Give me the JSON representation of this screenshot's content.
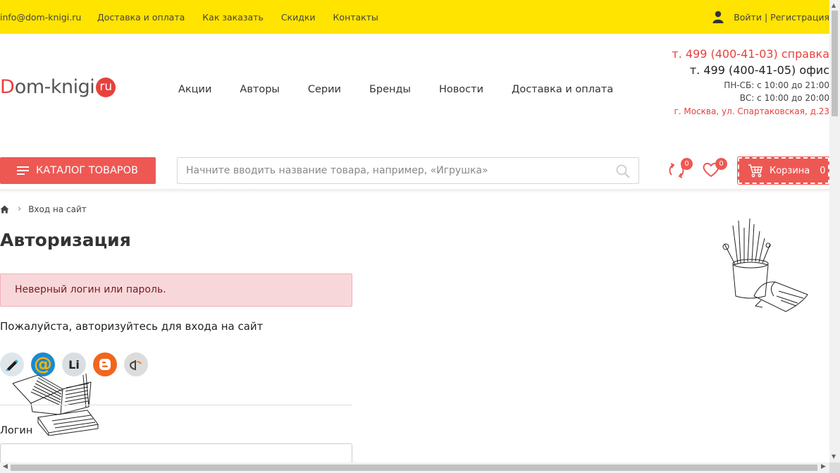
{
  "topbar": {
    "email": "info@dom-knigi.ru",
    "nav": [
      "Доставка и оплата",
      "Как заказать",
      "Скидки",
      "Контакты"
    ],
    "login": "Войти",
    "separator": "|",
    "register": "Регистрация"
  },
  "header": {
    "logo_d": "D",
    "logo_rest": "om-knigi",
    "logo_ru": "ru",
    "nav": [
      "Акции",
      "Авторы",
      "Серии",
      "Бренды",
      "Новости",
      "Доставка и оплата"
    ],
    "phone_help": "т. 499 (400-41-03) справка",
    "phone_office": "т. 499 (400-41-05) офис",
    "hours_weekdays": "ПН-СБ: с 10:00 до 21:00",
    "hours_sunday": "ВС: с 10:00 до 20:00",
    "address": "г. Москва, ул. Спартаковская, д.23"
  },
  "toolbar": {
    "catalog_label": "КАТАЛОГ ТОВАРОВ",
    "search_placeholder": "Начните вводить название товара, например, «Игрушка»",
    "compare_count": "0",
    "wishlist_count": "0",
    "cart_label": "Корзина",
    "cart_count": "0"
  },
  "breadcrumb": {
    "current": "Вход на сайт"
  },
  "page": {
    "title": "Авторизация",
    "error": "Неверный логин или пароль.",
    "prompt": "Пожалуйста, авторизуйтесь для входа на сайт",
    "login_label": "Логин"
  },
  "socials": {
    "livejournal_text": "Li"
  },
  "colors": {
    "topbar": "#ffe400",
    "accent": "#ee5853",
    "alert_bg": "#f8d7da",
    "alert_text": "#721c24"
  },
  "icons": [
    "user-icon",
    "hamburger-icon",
    "search-icon",
    "compare-icon",
    "heart-icon",
    "cart-icon",
    "home-icon",
    "chevron-right-icon"
  ]
}
